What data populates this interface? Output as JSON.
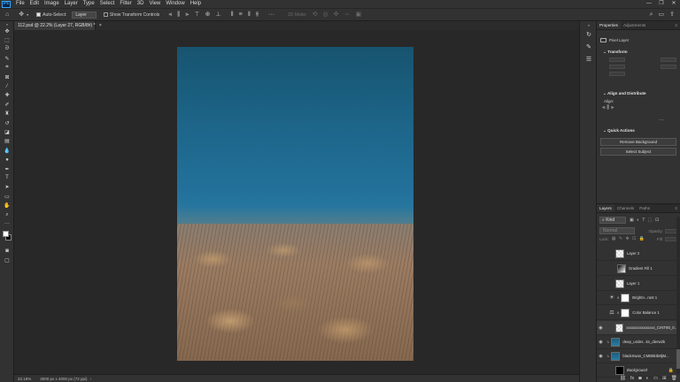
{
  "menu": [
    "File",
    "Edit",
    "Image",
    "Layer",
    "Type",
    "Select",
    "Filter",
    "3D",
    "View",
    "Window",
    "Help"
  ],
  "app_logo": "Ps",
  "window_controls": [
    "—",
    "❐",
    "✕"
  ],
  "options_bar": {
    "auto_select_label": "Auto-Select:",
    "auto_select_value": "Layer",
    "show_transform_label": "Show Transform Controls",
    "mode_3d_label": "3D Mode:"
  },
  "document": {
    "tab_title": "112.psd @ 22.2% (Layer 27, RGB/8#) *",
    "tab_close": "×"
  },
  "status_bar": {
    "zoom": "22.18%",
    "dimensions": "3000 px x 4000 px (72 ppi)"
  },
  "properties": {
    "tabs": [
      "Properties",
      "Adjustments"
    ],
    "layer_type": "Pixel Layer",
    "transform_title": "Transform",
    "align_title": "Align and Distribute",
    "align_label": "Align:",
    "quick_actions_title": "Quick Actions",
    "remove_bg_label": "Remove Background",
    "select_subject_label": "Select Subject"
  },
  "layers_panel": {
    "tabs": [
      "Layers",
      "Channels",
      "Paths"
    ],
    "filter_kind": "Kind",
    "blend_mode": "Normal",
    "opacity_label": "Opacity:",
    "lock_label": "Lock:",
    "fill_label": "Fill:",
    "layers": [
      {
        "name": "Layer 2",
        "thumb": "checker",
        "visible": false
      },
      {
        "name": "Gradient Fill 1",
        "thumb": "grad",
        "visible": false
      },
      {
        "name": "Layer 1",
        "thumb": "checker",
        "visible": false
      },
      {
        "name": "Brightn...rast 1",
        "thumb": "white",
        "visible": false
      },
      {
        "name": "Color Balance 1",
        "thumb": "white",
        "visible": false
      },
      {
        "name": "xxxxxxxxxxxxxxx_CINT80_0...",
        "thumb": "checker",
        "visible": true
      },
      {
        "name": "deep_under...ks_dierw2k",
        "thumb": "blue",
        "visible": true
      },
      {
        "name": "blackSwan_CMB8kIb8ljM...",
        "thumb": "blue",
        "visible": true
      },
      {
        "name": "Background",
        "thumb": "black",
        "visible": false
      }
    ]
  },
  "icons": {
    "eye": "👁",
    "lock": "🔒"
  }
}
